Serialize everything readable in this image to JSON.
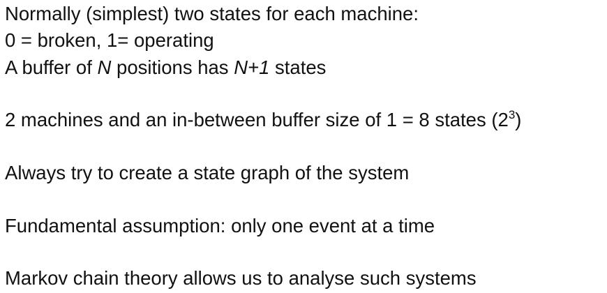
{
  "slide": {
    "line1": "Normally (simplest) two states for each machine:",
    "line2": "0 = broken, 1= operating",
    "line3": {
      "part1": "A buffer of ",
      "n": "N",
      "part2": " positions has ",
      "n_plus_1": "N+1",
      "part3": " states"
    },
    "line4": {
      "text": "2 machines and an in-between buffer size of 1 = 8 states (2",
      "exponent": "3",
      "close": ")"
    },
    "line5": "Always try to create a state graph of the system",
    "line6": "Fundamental assumption: only one event at a time",
    "line7": "Markov chain theory allows us to analyse such systems"
  }
}
